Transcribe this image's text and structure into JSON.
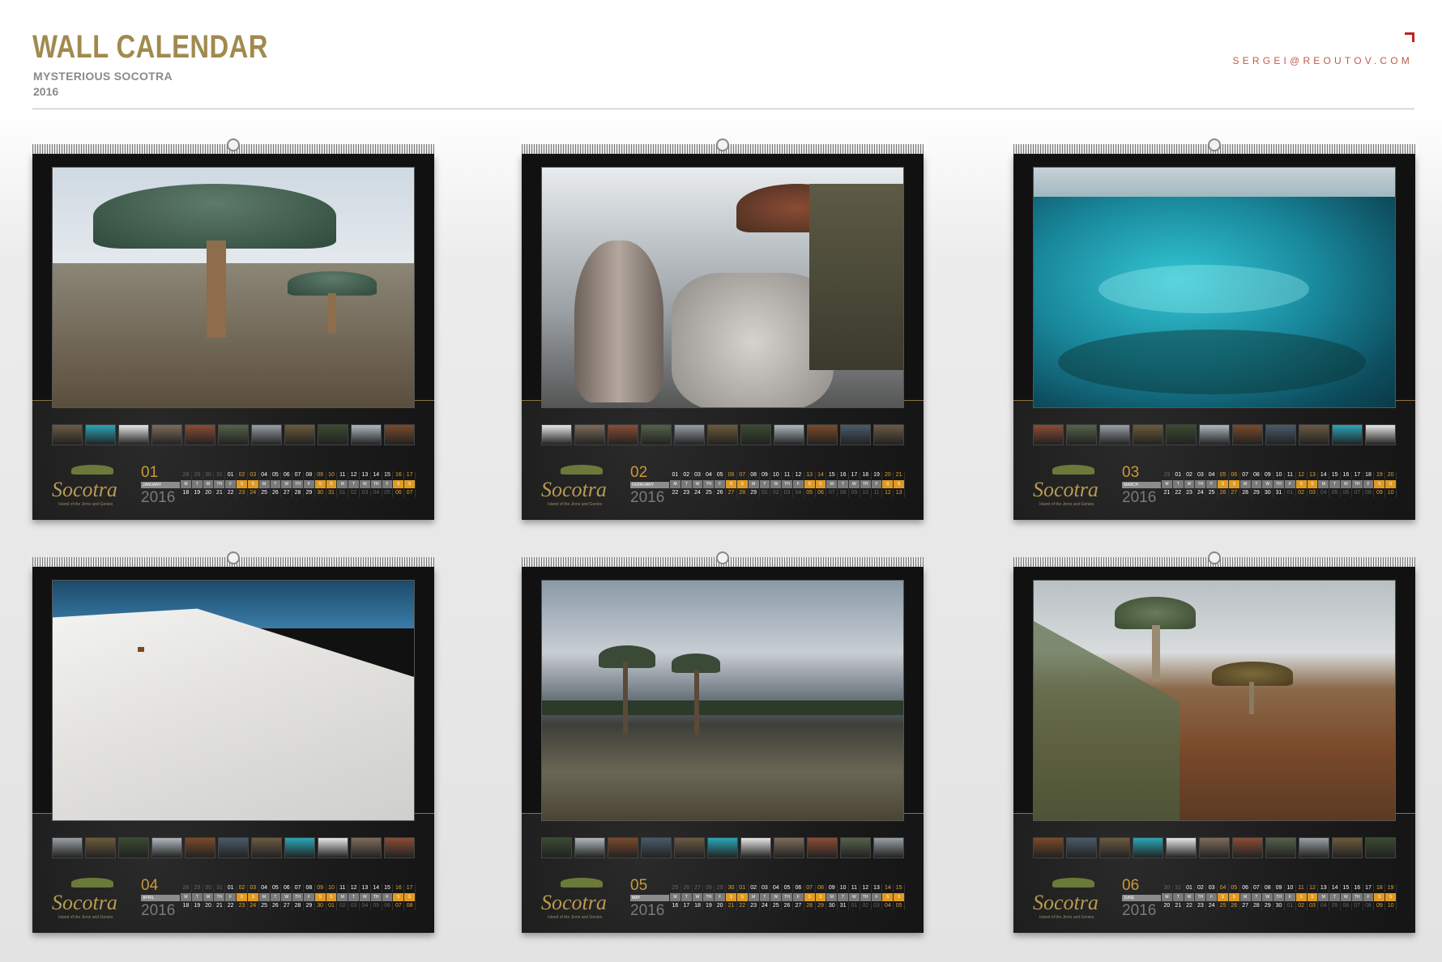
{
  "header": {
    "title": "WALL CALENDAR",
    "subtitle": "MYSTERIOUS SOCOTRA",
    "year": "2016",
    "email": "SERGEI@REOUTOV.COM"
  },
  "brand": {
    "logo_word": "Socotra",
    "logo_tagline": "Island of the Jinns and Genies"
  },
  "colors": {
    "title_gold": "#a08a4e",
    "accent_orange": "#e09a20",
    "email_red": "#c05a4a"
  },
  "weekday_labels": [
    "M",
    "T",
    "W",
    "TH",
    "F",
    "S",
    "S"
  ],
  "calendars": [
    {
      "month_num": "01",
      "month_name": "JANUARY",
      "year": "2016",
      "scene": "dragon-tree",
      "row1": [
        "28",
        "29",
        "30",
        "31",
        "01",
        "02",
        "03",
        "04",
        "05",
        "06",
        "07",
        "08",
        "09",
        "10",
        "11",
        "12",
        "13",
        "14",
        "15",
        "16",
        "17"
      ],
      "row2": [
        "18",
        "19",
        "20",
        "21",
        "22",
        "23",
        "24",
        "25",
        "26",
        "27",
        "28",
        "29",
        "30",
        "31",
        "01",
        "02",
        "03",
        "04",
        "05",
        "06",
        "07"
      ]
    },
    {
      "month_num": "02",
      "month_name": "FEBRUARY",
      "year": "2016",
      "scene": "bottle-trees",
      "row1": [
        "01",
        "02",
        "03",
        "04",
        "05",
        "06",
        "07",
        "08",
        "09",
        "10",
        "11",
        "12",
        "13",
        "14",
        "15",
        "16",
        "17",
        "18",
        "19",
        "20",
        "21"
      ],
      "row2": [
        "22",
        "23",
        "24",
        "25",
        "26",
        "27",
        "28",
        "29",
        "01",
        "02",
        "03",
        "04",
        "05",
        "06",
        "07",
        "08",
        "09",
        "10",
        "11",
        "12",
        "13"
      ]
    },
    {
      "month_num": "03",
      "month_name": "MARCH",
      "year": "2016",
      "scene": "lagoon",
      "row1": [
        "29",
        "01",
        "02",
        "03",
        "04",
        "05",
        "06",
        "07",
        "08",
        "09",
        "10",
        "11",
        "12",
        "13",
        "14",
        "15",
        "16",
        "17",
        "18",
        "19",
        "20"
      ],
      "row2": [
        "21",
        "22",
        "23",
        "24",
        "25",
        "26",
        "27",
        "28",
        "29",
        "30",
        "31",
        "01",
        "02",
        "03",
        "04",
        "05",
        "06",
        "07",
        "08",
        "09",
        "10"
      ]
    },
    {
      "month_num": "04",
      "month_name": "APRIL",
      "year": "2016",
      "scene": "dunes",
      "row1": [
        "28",
        "29",
        "30",
        "31",
        "01",
        "02",
        "03",
        "04",
        "05",
        "06",
        "07",
        "08",
        "09",
        "10",
        "11",
        "12",
        "13",
        "14",
        "15",
        "16",
        "17"
      ],
      "row2": [
        "18",
        "19",
        "20",
        "21",
        "22",
        "23",
        "24",
        "25",
        "26",
        "27",
        "28",
        "29",
        "30",
        "01",
        "02",
        "03",
        "04",
        "05",
        "06",
        "07",
        "08"
      ]
    },
    {
      "month_num": "05",
      "month_name": "MAY",
      "year": "2016",
      "scene": "palms",
      "row1": [
        "25",
        "26",
        "27",
        "28",
        "29",
        "30",
        "01",
        "02",
        "03",
        "04",
        "05",
        "06",
        "07",
        "08",
        "09",
        "10",
        "11",
        "12",
        "13",
        "14",
        "15"
      ],
      "row2": [
        "16",
        "17",
        "18",
        "19",
        "20",
        "21",
        "22",
        "23",
        "24",
        "25",
        "26",
        "27",
        "28",
        "29",
        "30",
        "31",
        "01",
        "02",
        "03",
        "04",
        "05"
      ]
    },
    {
      "month_num": "06",
      "month_name": "JUNE",
      "year": "2016",
      "scene": "dragon-hill",
      "row1": [
        "30",
        "31",
        "01",
        "02",
        "03",
        "04",
        "05",
        "06",
        "07",
        "08",
        "09",
        "10",
        "11",
        "12",
        "13",
        "14",
        "15",
        "16",
        "17",
        "18",
        "19"
      ],
      "row2": [
        "20",
        "21",
        "22",
        "23",
        "24",
        "25",
        "26",
        "27",
        "28",
        "29",
        "30",
        "01",
        "02",
        "03",
        "04",
        "05",
        "06",
        "07",
        "08",
        "09",
        "10"
      ]
    }
  ]
}
